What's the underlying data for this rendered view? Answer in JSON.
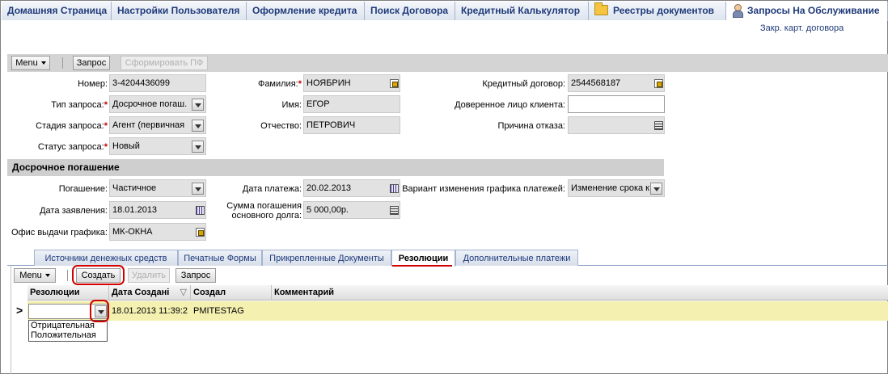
{
  "top_tabs": [
    {
      "label": "Домашняя Страница"
    },
    {
      "label": "Настройки Пользователя"
    },
    {
      "label": "Оформление кредита"
    },
    {
      "label": "Поиск Договора"
    },
    {
      "label": "Кредитный Калькулятор"
    },
    {
      "label": "Реестры документов",
      "icon": "folder-icon"
    },
    {
      "label": "Запросы На Обслуживание",
      "icon": "person-icon",
      "active": true
    }
  ],
  "sublink": "Закр. карт. договора",
  "toolbar": {
    "menu": "Menu",
    "request": "Запрос",
    "form_pf": "Сформировать ПФ"
  },
  "form": {
    "number_label": "Номер:",
    "number_value": "3-4204436099",
    "request_type_label": "Тип запроса:",
    "request_type_value": "Досрочное погаш.",
    "request_stage_label": "Стадия запроса:",
    "request_stage_value": "Агент (первичная",
    "request_status_label": "Статус запроса:",
    "request_status_value": "Новый",
    "surname_label": "Фамилия:",
    "surname_value": "НОЯБРИН",
    "name_label": "Имя:",
    "name_value": "ЕГОР",
    "patronymic_label": "Отчество:",
    "patronymic_value": "ПЕТРОВИЧ",
    "credit_contract_label": "Кредитный договор:",
    "credit_contract_value": "2544568187",
    "trusted_person_label": "Доверенное лицо клиента:",
    "trusted_person_value": "",
    "refusal_reason_label": "Причина отказа:",
    "refusal_reason_value": ""
  },
  "section": {
    "title": "Досрочное погашение",
    "repayment_label": "Погашение:",
    "repayment_value": "Частичное",
    "application_date_label": "Дата заявления:",
    "application_date_value": "18.01.2013",
    "schedule_office_label": "Офис выдачи графика:",
    "schedule_office_value": "МК-ОКНА",
    "payment_date_label": "Дата платежа:",
    "payment_date_value": "20.02.2013",
    "principal_sum_label_1": "Сумма погашения",
    "principal_sum_label_2": "основного долга:",
    "principal_sum_value": "5 000,00р.",
    "schedule_change_label": "Вариант изменения графика платежей:",
    "schedule_change_value": "Изменение срока к"
  },
  "sub_tabs": [
    {
      "label": "Источники денежных средств"
    },
    {
      "label": "Печатные Формы"
    },
    {
      "label": "Прикрепленные Документы"
    },
    {
      "label": "Резолюции",
      "active": true
    },
    {
      "label": "Дополнительные платежи"
    }
  ],
  "grid_toolbar": {
    "menu": "Menu",
    "create": "Создать",
    "delete": "Удалить",
    "request": "Запрос"
  },
  "grid": {
    "columns": [
      "Резолюции",
      "Дата Создані",
      "Создал",
      "Комментарий"
    ],
    "rows": [
      {
        "resolution": "",
        "created_date": "18.01.2013 11:39:2",
        "created_by": "PMITESTAG",
        "comment": ""
      }
    ],
    "dropdown_options": [
      "Отрицательная",
      "Положительная"
    ]
  },
  "annotation_color": "#d40000"
}
